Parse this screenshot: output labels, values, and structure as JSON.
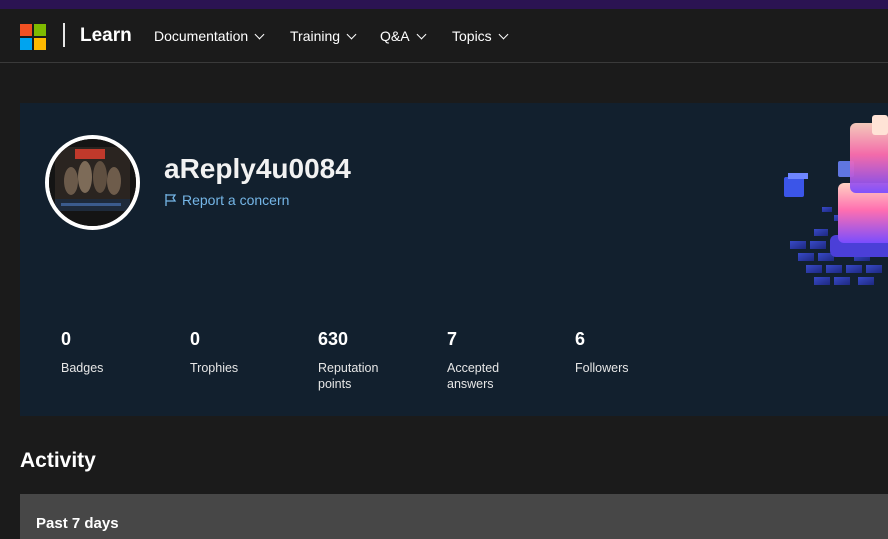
{
  "header": {
    "brand": "Learn",
    "nav": [
      {
        "label": "Documentation"
      },
      {
        "label": "Training"
      },
      {
        "label": "Q&A"
      },
      {
        "label": "Topics"
      }
    ],
    "logo_colors": [
      "#f25022",
      "#7fba00",
      "#00a4ef",
      "#ffb900"
    ]
  },
  "profile": {
    "username": "aReply4u0084",
    "report_label": "Report a concern",
    "stats": [
      {
        "value": "0",
        "label": "Badges"
      },
      {
        "value": "0",
        "label": "Trophies"
      },
      {
        "value": "630",
        "label": "Reputation points"
      },
      {
        "value": "7",
        "label": "Accepted answers"
      },
      {
        "value": "6",
        "label": "Followers"
      }
    ]
  },
  "activity": {
    "title": "Activity",
    "period_label": "Past 7 days"
  },
  "colors": {
    "accent_link": "#75b6e7",
    "page_bg": "#1b1b1b",
    "card_bg": "#12202e"
  }
}
